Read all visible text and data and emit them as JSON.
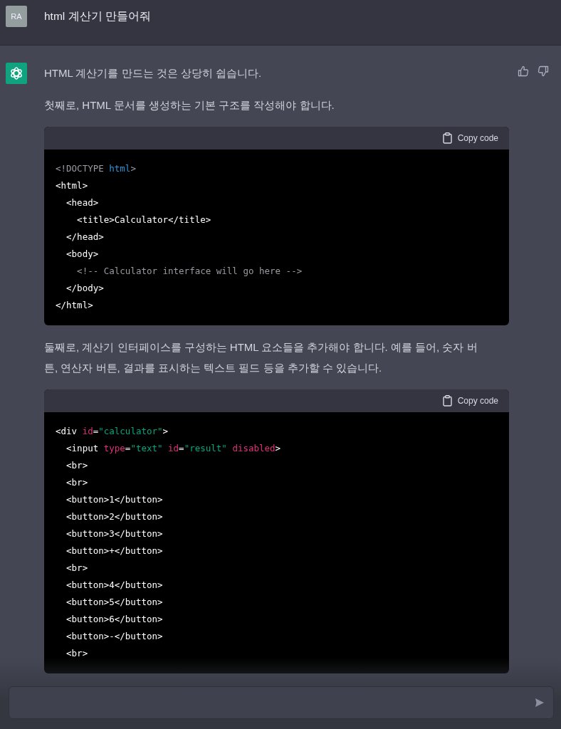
{
  "user_message": {
    "avatar": "RA",
    "text": "html 계산기 만들어줘"
  },
  "assistant_message": {
    "blocks": [
      {
        "kind": "paragraph",
        "text": "HTML 계산기를 만드는 것은 상당히 쉽습니다."
      },
      {
        "kind": "paragraph",
        "text": "첫째로, HTML 문서를 생성하는 기본 구조를 작성해야 합니다."
      },
      {
        "kind": "code",
        "copy_label": "Copy code",
        "lines": [
          [
            {
              "kind": "comment",
              "text": "<!DOCTYPE "
            },
            {
              "kind": "keyword",
              "text": "html"
            },
            {
              "kind": "comment",
              "text": ">"
            }
          ],
          [
            {
              "kind": "plain",
              "text": "<html>"
            }
          ],
          [
            {
              "kind": "plain",
              "text": "  <head>"
            }
          ],
          [
            {
              "kind": "plain",
              "text": "    <title>Calculator</title>"
            }
          ],
          [
            {
              "kind": "plain",
              "text": "  </head>"
            }
          ],
          [
            {
              "kind": "plain",
              "text": "  <body>"
            }
          ],
          [
            {
              "kind": "comment",
              "text": "    <!-- Calculator interface will go here -->"
            }
          ],
          [
            {
              "kind": "plain",
              "text": "  </body>"
            }
          ],
          [
            {
              "kind": "plain",
              "text": "</html>"
            }
          ]
        ]
      },
      {
        "kind": "paragraph",
        "text": "둘째로, 계산기 인터페이스를 구성하는 HTML 요소들을 추가해야 합니다. 예를 들어, 숫자 버튼, 연산자 버튼, 결과를 표시하는 텍스트 필드 등을 추가할 수 있습니다."
      },
      {
        "kind": "code",
        "copy_label": "Copy code",
        "lines": [
          [
            {
              "kind": "plain",
              "text": "<div "
            },
            {
              "kind": "attr",
              "text": "id"
            },
            {
              "kind": "plain",
              "text": "="
            },
            {
              "kind": "string",
              "text": "\"calculator\""
            },
            {
              "kind": "plain",
              "text": ">"
            }
          ],
          [
            {
              "kind": "plain",
              "text": "  <input "
            },
            {
              "kind": "attr",
              "text": "type"
            },
            {
              "kind": "plain",
              "text": "="
            },
            {
              "kind": "string",
              "text": "\"text\""
            },
            {
              "kind": "attr",
              "text": " id"
            },
            {
              "kind": "plain",
              "text": "="
            },
            {
              "kind": "string",
              "text": "\"result\""
            },
            {
              "kind": "attr",
              "text": " disabled"
            },
            {
              "kind": "plain",
              "text": ">"
            }
          ],
          [
            {
              "kind": "plain",
              "text": "  <br>"
            }
          ],
          [
            {
              "kind": "plain",
              "text": "  <br>"
            }
          ],
          [
            {
              "kind": "plain",
              "text": "  <button>1</button>"
            }
          ],
          [
            {
              "kind": "plain",
              "text": "  <button>2</button>"
            }
          ],
          [
            {
              "kind": "plain",
              "text": "  <button>3</button>"
            }
          ],
          [
            {
              "kind": "plain",
              "text": "  <button>+</button>"
            }
          ],
          [
            {
              "kind": "plain",
              "text": "  <br>"
            }
          ],
          [
            {
              "kind": "plain",
              "text": "  <button>4</button>"
            }
          ],
          [
            {
              "kind": "plain",
              "text": "  <button>5</button>"
            }
          ],
          [
            {
              "kind": "plain",
              "text": "  <button>6</button>"
            }
          ],
          [
            {
              "kind": "plain",
              "text": "  <button>-</button>"
            }
          ],
          [
            {
              "kind": "plain",
              "text": "  <br>"
            }
          ]
        ]
      }
    ]
  }
}
